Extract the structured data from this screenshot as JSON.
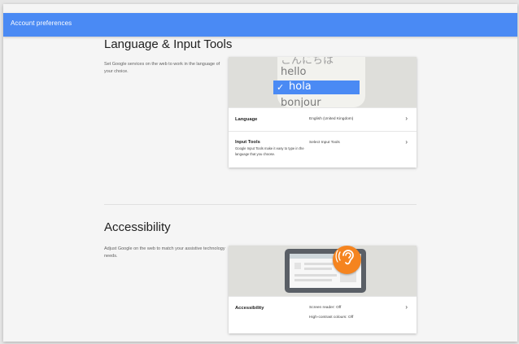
{
  "header": {
    "title": "Account preferences"
  },
  "language_section": {
    "title": "Language & Input Tools",
    "description": "Set Google services on the web to work in the language of your choice.",
    "hero": {
      "word_above_faded": "こんにちは",
      "word_above": "hello",
      "word_selected": "hola",
      "word_below": "bonjour"
    },
    "rows": [
      {
        "label": "Language",
        "value": "English (United Kingdom)"
      },
      {
        "label": "Input Tools",
        "sub": "Google Input Tools make it easy to type in the language that you choose.",
        "value": "Select Input Tools"
      }
    ]
  },
  "accessibility_section": {
    "title": "Accessibility",
    "description": "Adjust Google on the web to match your assistive technology needs.",
    "rows": [
      {
        "label": "Accessibility",
        "value": "Screen reader: Off",
        "value2": "High-contrast colours: Off"
      }
    ]
  },
  "colors": {
    "accent": "#4a8af4",
    "badge": "#f5841f"
  },
  "icons": {
    "chevron": "chevron-right-icon",
    "check": "check-icon",
    "ear": "hearing-icon"
  }
}
